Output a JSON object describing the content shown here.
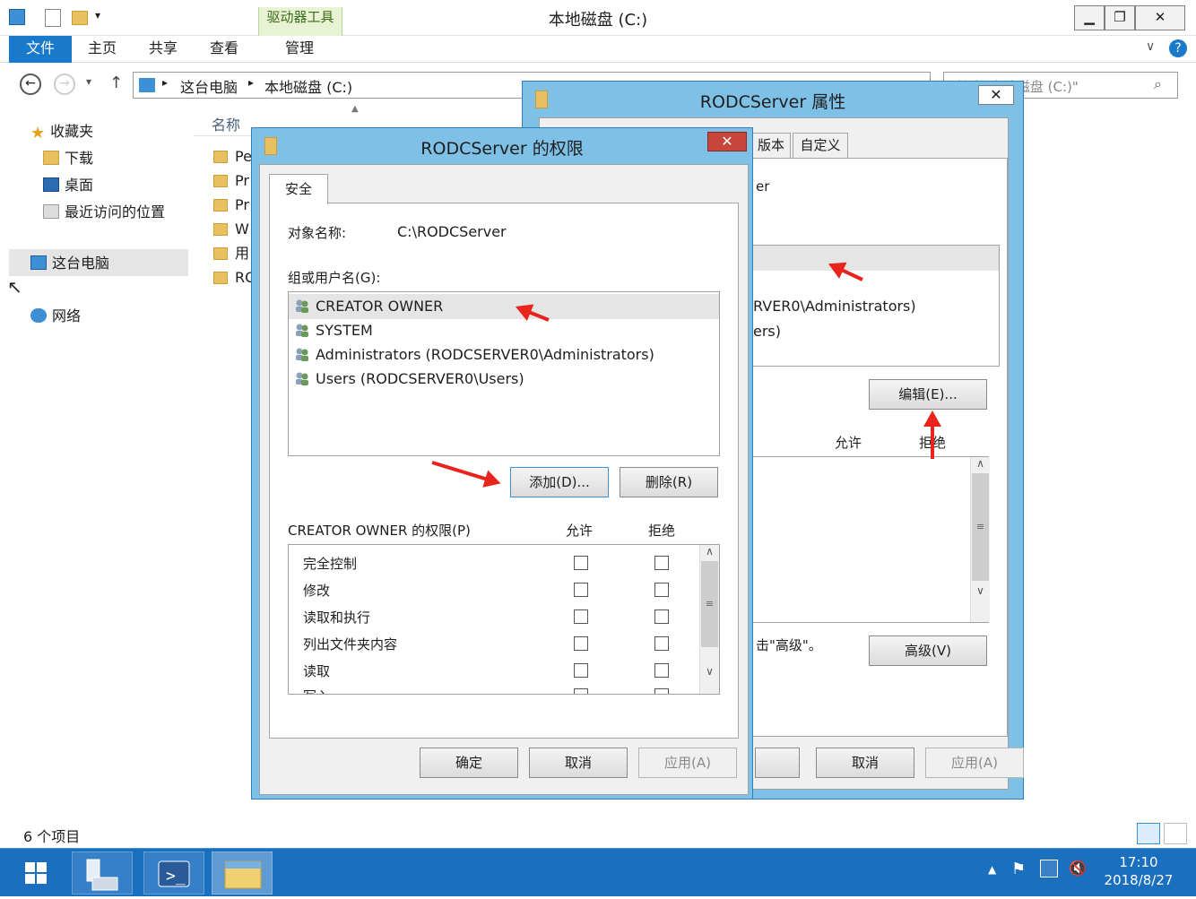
{
  "explorer": {
    "title": "本地磁盘 (C:)",
    "context_tab_group": "驱动器工具",
    "ribbon_tabs": [
      "文件",
      "主页",
      "共享",
      "查看",
      "管理"
    ],
    "breadcrumb": [
      "这台电脑",
      "本地磁盘 (C:)"
    ],
    "search_placeholder": "搜索\"本地磁盘 (C:)\"",
    "column_header": "名称",
    "nav": {
      "favorites": "收藏夹",
      "downloads": "下载",
      "desktop": "桌面",
      "recent": "最近访问的位置",
      "this_pc": "这台电脑",
      "network": "网络"
    },
    "files": [
      "Pe",
      "Pr",
      "Pr",
      "W",
      "用",
      "RO"
    ],
    "status": "6 个项目"
  },
  "properties_dialog": {
    "title": "RODCServer 属性",
    "tabs": [
      "版本",
      "自定义"
    ],
    "partial_text_1": "er",
    "partial_user_1": "RVER0\\Administrators)",
    "partial_user_2": "ers)",
    "edit_button": "编辑(E)...",
    "allow_header": "允许",
    "deny_header": "拒绝",
    "advanced_hint": "击\"高级\"。",
    "advanced_button": "高级(V)",
    "cancel_button": "取消",
    "apply_button": "应用(A)"
  },
  "permissions_dialog": {
    "title": "RODCServer 的权限",
    "tab": "安全",
    "object_label": "对象名称:",
    "object_value": "C:\\RODCServer",
    "group_label": "组或用户名(G):",
    "users": [
      "CREATOR OWNER",
      "SYSTEM",
      "Administrators (RODCSERVER0\\Administrators)",
      "Users (RODCSERVER0\\Users)"
    ],
    "add_button": "添加(D)...",
    "remove_button": "删除(R)",
    "perm_label": "CREATOR OWNER 的权限(P)",
    "allow_header": "允许",
    "deny_header": "拒绝",
    "permissions": [
      "完全控制",
      "修改",
      "读取和执行",
      "列出文件夹内容",
      "读取",
      "写入"
    ],
    "ok_button": "确定",
    "cancel_button": "取消",
    "apply_button": "应用(A)"
  },
  "taskbar": {
    "time": "17:10",
    "date": "2018/8/27"
  },
  "colors": {
    "dialog_frame": "#7fc0e6",
    "taskbar": "#1a6fbf",
    "close_red": "#c7453a",
    "annotation_arrow": "#e8241c"
  }
}
